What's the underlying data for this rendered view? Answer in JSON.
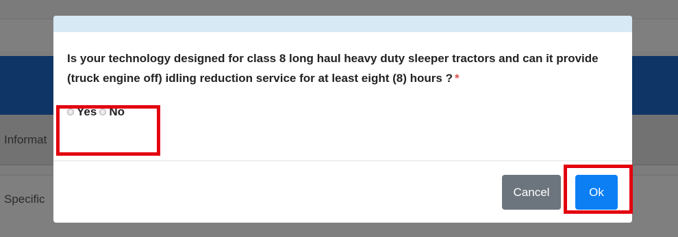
{
  "background": {
    "row_label_1": "Informat",
    "row_label_2": "Specific"
  },
  "dialog": {
    "question": "Is your technology designed for class 8 long haul heavy duty sleeper tractors and can it provide (truck engine off) idling reduction service for at least eight (8) hours ?",
    "required_marker": "*",
    "options": {
      "yes": "Yes",
      "no": "No"
    },
    "buttons": {
      "cancel": "Cancel",
      "ok": "Ok"
    },
    "colors": {
      "header": "#d7e9f5",
      "cancel": "#6c757d",
      "ok": "#0d7ff5",
      "highlight": "#e3000f"
    }
  }
}
